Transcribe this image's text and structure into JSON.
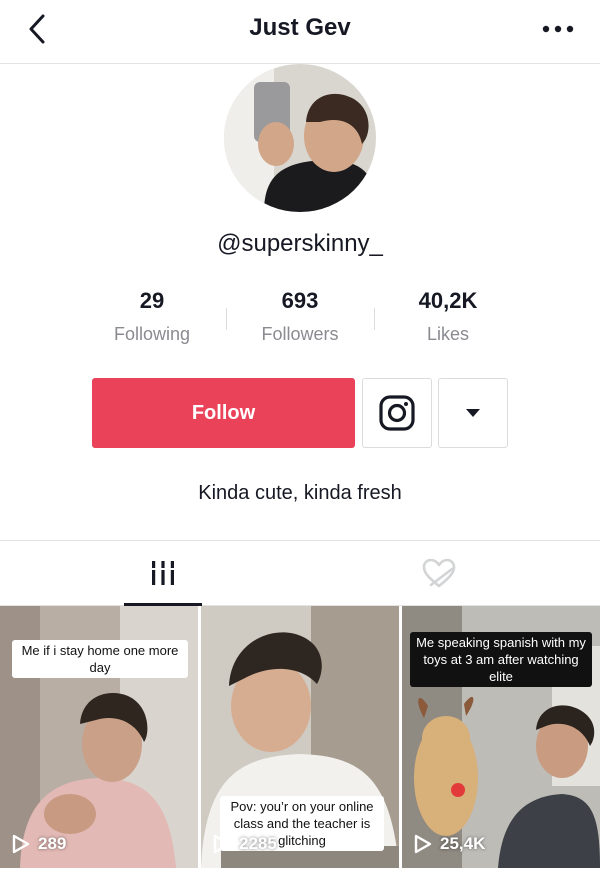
{
  "header": {
    "title": "Just Gev",
    "back_icon": "chevron-left-icon",
    "more_icon": "more-horizontal-icon"
  },
  "profile": {
    "username": "@superskinny_",
    "bio": "Kinda cute, kinda fresh"
  },
  "stats": [
    {
      "value": "29",
      "label": "Following"
    },
    {
      "value": "693",
      "label": "Followers"
    },
    {
      "value": "40,2K",
      "label": "Likes"
    }
  ],
  "actions": {
    "follow_label": "Follow",
    "follow_color": "#ea4359",
    "instagram_icon": "instagram-icon",
    "dropdown_icon": "caret-down-icon"
  },
  "tabs": [
    {
      "name": "videos",
      "icon": "grid-icon",
      "active": true
    },
    {
      "name": "liked",
      "icon": "heart-hidden-icon",
      "active": false
    }
  ],
  "videos": [
    {
      "caption": "Me if i stay home one more day",
      "views": "289"
    },
    {
      "caption": "Pov: you’r on  your online class and the teacher is glitching",
      "views": "2285"
    },
    {
      "caption": "Me speaking spanish with my toys at 3 am after watching elite",
      "views": "25,4K"
    }
  ]
}
